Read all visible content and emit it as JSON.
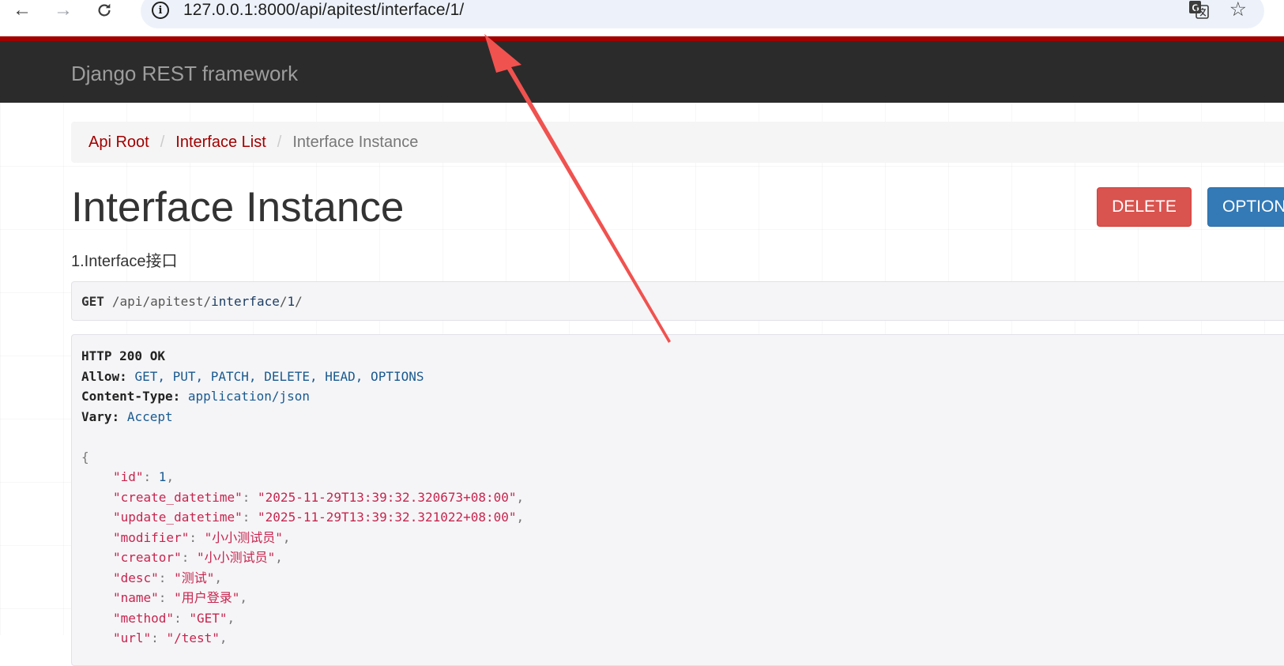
{
  "browser": {
    "url": "127.0.0.1:8000/api/apitest/interface/1/"
  },
  "navbar": {
    "brand": "Django REST framework"
  },
  "breadcrumb": {
    "items": [
      "Api Root",
      "Interface List"
    ],
    "active": "Interface Instance",
    "separator": "/"
  },
  "page": {
    "title": "Interface Instance",
    "description": "1.Interface接口",
    "buttons": {
      "delete_label": "DELETE",
      "options_label": "OPTIONS"
    }
  },
  "request": {
    "method": "GET",
    "path_segments": [
      "/api/apitest/",
      "interface",
      "/",
      "1",
      "/"
    ]
  },
  "response": {
    "status": "HTTP 200 OK",
    "headers": [
      {
        "key": "Allow:",
        "value": "GET, PUT, PATCH, DELETE, HEAD, OPTIONS"
      },
      {
        "key": "Content-Type:",
        "value": "application/json"
      },
      {
        "key": "Vary:",
        "value": "Accept"
      }
    ],
    "json_open": "{",
    "json_fields": [
      {
        "key": "\"id\"",
        "value": "1",
        "type": "number"
      },
      {
        "key": "\"create_datetime\"",
        "value": "\"2025-11-29T13:39:32.320673+08:00\"",
        "type": "string"
      },
      {
        "key": "\"update_datetime\"",
        "value": "\"2025-11-29T13:39:32.321022+08:00\"",
        "type": "string"
      },
      {
        "key": "\"modifier\"",
        "value": "\"小小测试员\"",
        "type": "string"
      },
      {
        "key": "\"creator\"",
        "value": "\"小小测试员\"",
        "type": "string"
      },
      {
        "key": "\"desc\"",
        "value": "\"测试\"",
        "type": "string"
      },
      {
        "key": "\"name\"",
        "value": "\"用户登录\"",
        "type": "string"
      },
      {
        "key": "\"method\"",
        "value": "\"GET\"",
        "type": "string"
      },
      {
        "key": "\"url\"",
        "value": "\"/test\"",
        "type": "string"
      }
    ]
  },
  "colors": {
    "brand_red": "#a30000",
    "navbar_bg": "#2b2b2b",
    "delete_button": "#d9534f",
    "options_button": "#337ab7",
    "annotation_arrow": "#f0524f"
  },
  "icons": {
    "back": "arrow-left-icon",
    "forward": "arrow-right-icon",
    "reload": "reload-icon",
    "site_info": "info-icon",
    "translate": "translate-icon",
    "bookmark": "star-icon"
  }
}
